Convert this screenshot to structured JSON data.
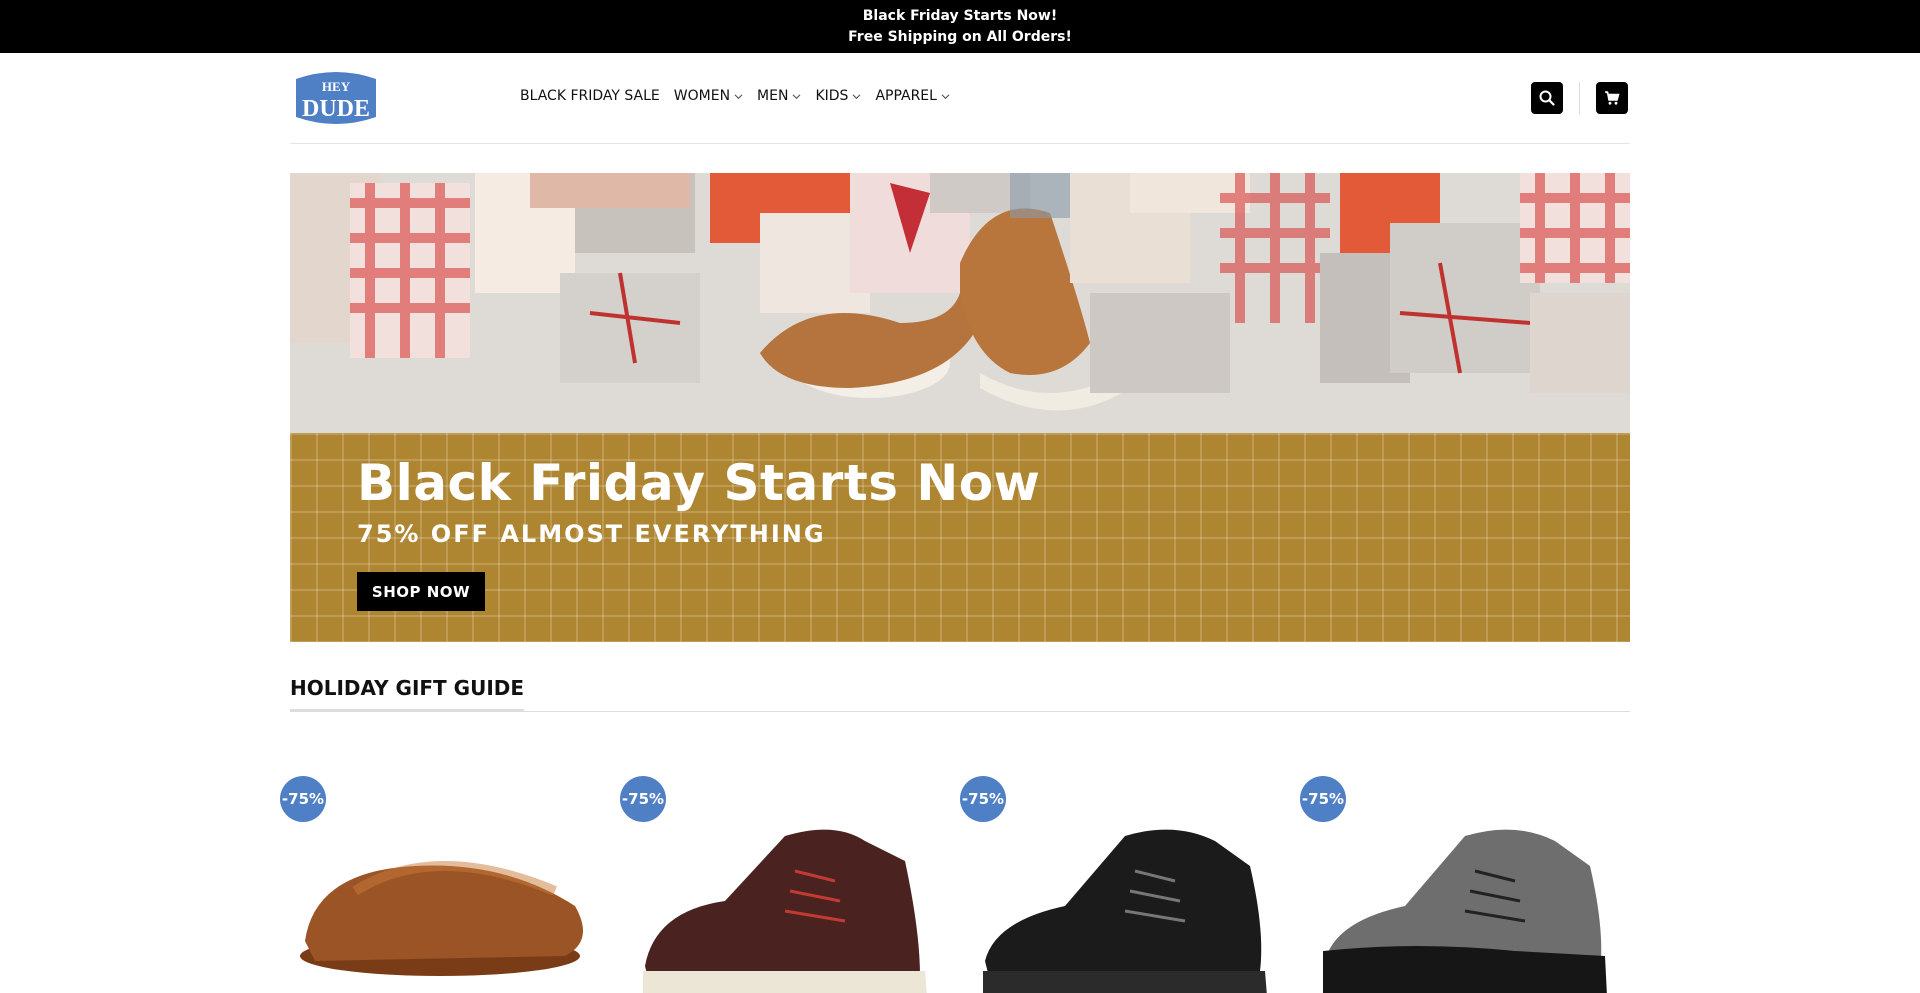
{
  "announcement": {
    "line1": "Black Friday Starts Now!",
    "line2": "Free Shipping on All Orders!"
  },
  "header": {
    "logo_text_top": "HEY",
    "logo_text_bottom": "DUDE",
    "nav": [
      {
        "label": "BLACK FRIDAY SALE",
        "has_dropdown": false
      },
      {
        "label": "WOMEN",
        "has_dropdown": true
      },
      {
        "label": "MEN",
        "has_dropdown": true
      },
      {
        "label": "KIDS",
        "has_dropdown": true
      },
      {
        "label": "APPAREL",
        "has_dropdown": true
      }
    ],
    "icons": [
      "search-icon",
      "cart-icon"
    ]
  },
  "hero": {
    "title": "Black Friday Starts Now",
    "subtitle": "75% OFF ALMOST EVERYTHING",
    "cta": "SHOP NOW"
  },
  "section": {
    "title": "HOLIDAY GIFT GUIDE"
  },
  "products": [
    {
      "badge": "-75%",
      "color": "#8a4a1e"
    },
    {
      "badge": "-75%",
      "color": "#4a2320"
    },
    {
      "badge": "-75%",
      "color": "#1b1b1b"
    },
    {
      "badge": "-75%",
      "color": "#6e6e6e"
    }
  ],
  "colors": {
    "brand_blue": "#4f7fc4",
    "hero_gold": "#ae8530",
    "black": "#000000"
  }
}
